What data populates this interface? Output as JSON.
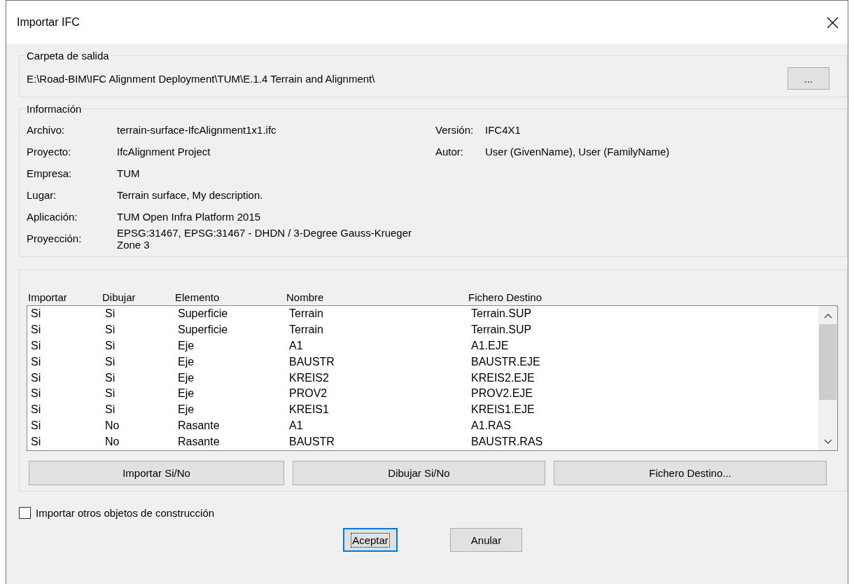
{
  "window": {
    "title": "Importar IFC"
  },
  "output_folder": {
    "label": "Carpeta de salida",
    "path": "E:\\Road-BIM\\IFC Alignment Deployment\\TUM\\E.1.4 Terrain and Alignment\\",
    "browse_button": "..."
  },
  "information": {
    "label": "Información",
    "fields": [
      {
        "label": "Archivo:",
        "value": "terrain-surface-IfcAlignment1x1.ifc"
      },
      {
        "label": "Proyecto:",
        "value": "IfcAlignment Project"
      },
      {
        "label": "Empresa:",
        "value": "TUM"
      },
      {
        "label": "Lugar:",
        "value": "Terrain surface, My description."
      },
      {
        "label": "Aplicación:",
        "value": "TUM Open Infra Platform 2015"
      },
      {
        "label": "Proyección:",
        "value": "EPSG:31467, EPSG:31467 - DHDN / 3-Degree Gauss-Krueger Zone 3"
      }
    ],
    "side_fields": [
      {
        "label": "Versión:",
        "value": "IFC4X1"
      },
      {
        "label": "Autor:",
        "value": "User (GivenName), User (FamilyName)"
      }
    ]
  },
  "elements": {
    "columns": [
      "Importar",
      "Dibujar",
      "Elemento",
      "Nombre",
      "Fichero Destino"
    ],
    "rows": [
      [
        "Si",
        "Si",
        "Superficie",
        "Terrain",
        "Terrain.SUP"
      ],
      [
        "Si",
        "Si",
        "Superficie",
        "Terrain",
        "Terrain.SUP"
      ],
      [
        "Si",
        "Si",
        "Eje",
        "A1",
        "A1.EJE"
      ],
      [
        "Si",
        "Si",
        "Eje",
        "BAUSTR",
        "BAUSTR.EJE"
      ],
      [
        "Si",
        "Si",
        "Eje",
        "KREIS2",
        "KREIS2.EJE"
      ],
      [
        "Si",
        "Si",
        "Eje",
        "PROV2",
        "PROV2.EJE"
      ],
      [
        "Si",
        "Si",
        "Eje",
        "KREIS1",
        "KREIS1.EJE"
      ],
      [
        "Si",
        "No",
        "Rasante",
        "A1",
        "A1.RAS"
      ],
      [
        "Si",
        "No",
        "Rasante",
        "BAUSTR",
        "BAUSTR.RAS"
      ]
    ],
    "buttons": [
      "Importar Si/No",
      "Dibujar Si/No",
      "Fichero Destino..."
    ]
  },
  "import_other": {
    "label": "Importar otros objetos de construcción",
    "checked": false
  },
  "buttons": [
    {
      "label": "Aceptar",
      "default": true
    },
    {
      "label": "Anular",
      "default": false
    }
  ]
}
